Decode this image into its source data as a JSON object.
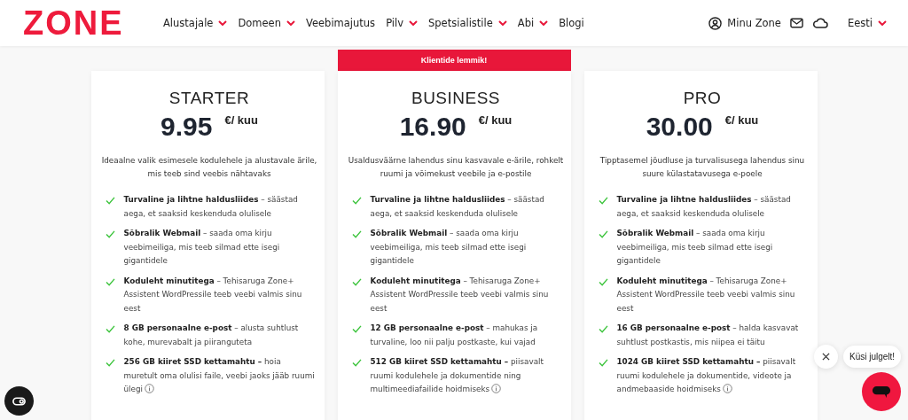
{
  "header": {
    "logo": "ZONE",
    "nav": [
      {
        "label": "Alustajale",
        "dropdown": true
      },
      {
        "label": "Domeen",
        "dropdown": true
      },
      {
        "label": "Veebimajutus",
        "dropdown": false
      },
      {
        "label": "Pilv",
        "dropdown": true
      },
      {
        "label": "Spetsialistile",
        "dropdown": true
      },
      {
        "label": "Abi",
        "dropdown": true
      },
      {
        "label": "Blogi",
        "dropdown": false
      }
    ],
    "account": "Minu Zone",
    "language": "Eesti"
  },
  "plans": [
    {
      "name": "STARTER",
      "price": "9.95",
      "unit": "€/ kuu",
      "description": "Ideaalne valik esimesele kodulehele ja alustavale ärile, mis teeb sind veebis nähtavaks",
      "features": [
        {
          "text": "**Turvaline ja lihtne haldusliides** – säästad aega, et saaksid keskenduda olulisele",
          "info": false
        },
        {
          "text": "**Sõbralik Webmail** – saada oma kirju veebimeiliga, mis teeb silmad ette isegi gigantidele",
          "info": false
        },
        {
          "text": "**Koduleht minutitega** – Tehisaruga Zone+ Assistent WordPressile teeb veebi valmis sinu eest",
          "info": false
        },
        {
          "text": "**8 GB personaalne e-post** – alusta suhtlust kohe, murevabalt ja piiranguteta",
          "info": false
        },
        {
          "text": "**256 GB kiiret SSD kettamahtu –** hoia muretult oma olulisi faile, veebi jaoks jääb ruumi ülegi",
          "info": true
        }
      ]
    },
    {
      "name": "BUSINESS",
      "price": "16.90",
      "unit": "€/ kuu",
      "badge": "Klientide lemmik!",
      "description": "Usaldusväärne lahendus sinu kasvavale e-ärile, rohkelt ruumi ja võimekust veebile ja e-postile",
      "features": [
        {
          "text": "**Turvaline ja lihtne haldusliides** – säästad aega, et saaksid keskenduda olulisele",
          "info": false
        },
        {
          "text": "**Sõbralik Webmail** – saada oma kirju veebimeiliga, mis teeb silmad ette isegi gigantidele",
          "info": false
        },
        {
          "text": "**Koduleht minutitega** – Tehisaruga Zone+ Assistent WordPressile teeb veebi valmis sinu eest",
          "info": false
        },
        {
          "text": "**12 GB personaalne e-post** – mahukas ja turvaline, loo nii palju postkaste, kui vajad",
          "info": false
        },
        {
          "text": "**512 GB kiiret SSD kettamahtu –** piisavalt ruumi kodulehele ja dokumentide ning multimeediafailide hoidmiseks",
          "info": true
        }
      ]
    },
    {
      "name": "PRO",
      "price": "30.00",
      "unit": "€/ kuu",
      "description": "Tipptasemel jõudluse ja turvalisusega lahendus sinu suure külastatavusega e-poele",
      "features": [
        {
          "text": "**Turvaline ja lihtne haldusliides** – säästad aega, et saaksid keskenduda olulisele",
          "info": false
        },
        {
          "text": "**Sõbralik Webmail** – saada oma kirju veebimeiliga, mis teeb silmad ette isegi gigantidele",
          "info": false
        },
        {
          "text": "**Koduleht minutitega** – Tehisaruga Zone+ Assistent WordPressile teeb veebi valmis sinu eest",
          "info": false
        },
        {
          "text": "**16 GB personaalne e-post** – halda kasvavat suhtlust postkastis, mis niipea ei täitu",
          "info": false
        },
        {
          "text": "**1024 GB kiiret SSD kettamahtu –** piisavalt ruumi kodulehele ja dokumentide, videote ja andmebaaside hoidmiseks",
          "info": true
        }
      ]
    }
  ],
  "chat": {
    "prompt": "Küsi julgelt!"
  }
}
